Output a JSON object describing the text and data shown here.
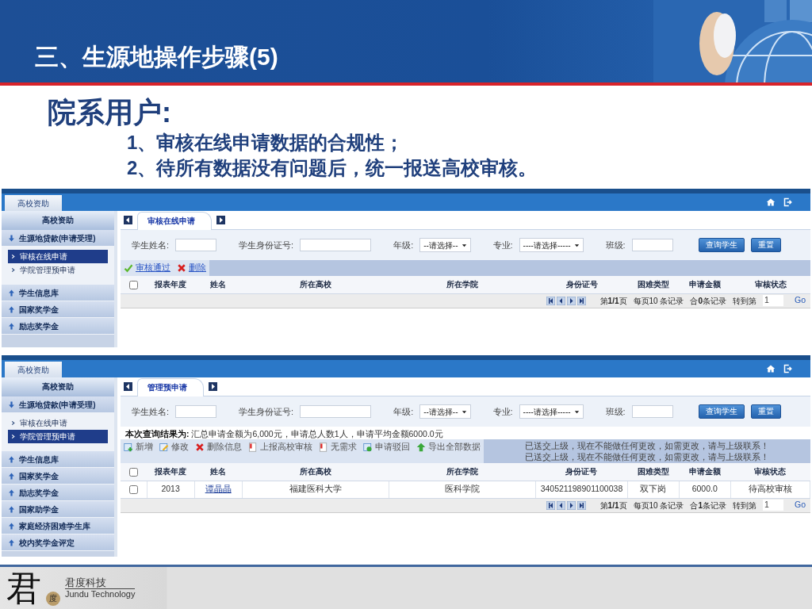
{
  "slide": {
    "title": "三、生源地操作步骤(5)",
    "heading": "院系用户:",
    "steps": [
      "1、审核在线申请数据的合规性；",
      "2、待所有数据没有问题后，统一报送高校审核。"
    ]
  },
  "screens": [
    {
      "top_tab": "高校资助",
      "sidebar": {
        "title": "高校资助",
        "groups": [
          {
            "label": "生源地贷款(申请受理)",
            "expanded": true,
            "children": [
              {
                "label": "审核在线申请",
                "selected": true
              },
              {
                "label": "学院管理预申请",
                "selected": false
              }
            ]
          },
          {
            "label": "学生信息库",
            "expanded": false
          },
          {
            "label": "国家奖学金",
            "expanded": false
          },
          {
            "label": "励志奖学金",
            "expanded": false
          }
        ]
      },
      "page_tab": "审核在线申请",
      "filters": [
        {
          "label": "学生姓名:",
          "kind": "input"
        },
        {
          "label": "学生身份证号:",
          "kind": "input"
        },
        {
          "label": "年级:",
          "kind": "select",
          "value": "--请选择--"
        },
        {
          "label": "专业:",
          "kind": "select",
          "value": "----请选择-----"
        },
        {
          "label": "班级:",
          "kind": "input"
        }
      ],
      "buttons": [
        "查询学生",
        "重置"
      ],
      "toolbar": [
        {
          "kind": "check",
          "label": "审核通过",
          "link": true
        },
        {
          "kind": "cross",
          "label": "删除",
          "link": true
        }
      ],
      "table": {
        "select_all": {
          "checked": false
        },
        "columns": [
          {
            "label": "报表年度"
          },
          {
            "label": "姓名"
          },
          {
            "label": "所在高校"
          },
          {
            "label": "所在学院"
          },
          {
            "label": "身份证号"
          },
          {
            "label": "困难类型"
          },
          {
            "label": "申请金额"
          },
          {
            "label": "审核状态"
          }
        ]
      },
      "pager": {
        "page": "第**1/1**页",
        "per_page": "每页10 条记录",
        "total": "合**0**条记录",
        "goto": "转到第",
        "goto_value": "1",
        "go": "Go"
      }
    },
    {
      "top_tab": "高校资助",
      "sidebar": {
        "title": "高校资助",
        "groups": [
          {
            "label": "生源地贷款(申请受理)",
            "expanded": true,
            "children": [
              {
                "label": "审核在线申请",
                "selected": false
              },
              {
                "label": "学院管理预申请",
                "selected": true
              }
            ]
          },
          {
            "label": "学生信息库",
            "expanded": false
          },
          {
            "label": "国家奖学金",
            "expanded": false
          },
          {
            "label": "励志奖学金",
            "expanded": false
          },
          {
            "label": "国家助学金",
            "expanded": false
          },
          {
            "label": "家庭经济困难学生库",
            "expanded": false
          },
          {
            "label": "校内奖学金评定",
            "expanded": false
          }
        ]
      },
      "page_tab": "管理预申请",
      "filters": [
        {
          "label": "学生姓名:",
          "kind": "input"
        },
        {
          "label": "学生身份证号:",
          "kind": "input"
        },
        {
          "label": "年级:",
          "kind": "select",
          "value": "--请选择--"
        },
        {
          "label": "专业:",
          "kind": "select",
          "value": "----请选择-----"
        },
        {
          "label": "班级:",
          "kind": "input"
        }
      ],
      "buttons": [
        "查询学生",
        "重置"
      ],
      "summary": "**本次查询结果为:** 汇总申请金额为6,000元，申请总人数1人，申请平均金额6000.0元",
      "toolbar": [
        {
          "kind": "add",
          "label": "新增",
          "link": false
        },
        {
          "kind": "edit",
          "label": "修改",
          "link": false
        },
        {
          "kind": "cross",
          "label": "删除信息",
          "link": false
        },
        {
          "kind": "flag",
          "label": "上报高校审核",
          "link": false
        },
        {
          "kind": "flag",
          "label": "无需求",
          "link": false
        },
        {
          "kind": "refresh",
          "label": "申请驳回",
          "link": false
        },
        {
          "kind": "up",
          "label": "导出全部数据",
          "link": false
        }
      ],
      "notices": [
        "已送交上级，现在不能做任何更改，如需更改，请与上级联系！",
        "已送交上级，现在不能做任何更改，如需更改，请与上级联系！"
      ],
      "table": {
        "select_all": {
          "checked": false
        },
        "columns": [
          {
            "label": "报表年度"
          },
          {
            "label": "姓名",
            "link": true
          },
          {
            "label": "所在高校"
          },
          {
            "label": "所在学院"
          },
          {
            "label": "身份证号"
          },
          {
            "label": "困难类型"
          },
          {
            "label": "申请金额"
          },
          {
            "label": "审核状态"
          }
        ],
        "rows": [
          {
            "checked": false,
            "cells": [
              "2013",
              "谭晶晶",
              "福建医科大学",
              "医科学院",
              "340521198901100038",
              "双下岗",
              "6000.0",
              "待高校审核"
            ]
          }
        ]
      },
      "pager": {
        "page": "第**1/1**页",
        "per_page": "每页10 条记录",
        "total": "合**1**条记录",
        "goto": "转到第",
        "goto_value": "1",
        "go": "Go"
      }
    }
  ],
  "footer": {
    "logo_char": "君",
    "logo_badge": "度",
    "brand": "君度科技",
    "brand_en": "Jundu Technology"
  }
}
